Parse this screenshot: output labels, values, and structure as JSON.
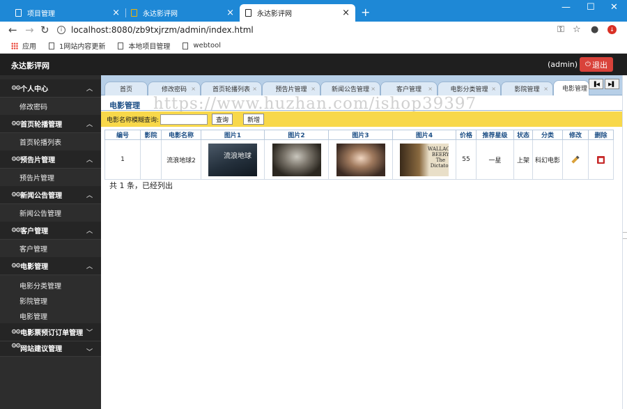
{
  "browser": {
    "tabs": [
      {
        "title": "项目管理"
      },
      {
        "title": "永达影评网"
      },
      {
        "title": "永达影评网"
      }
    ],
    "url": "localhost:8080/zb9txjrzm/admin/index.html",
    "bookmarks": [
      "应用",
      "1网站内容更新",
      "本地项目管理",
      "webtool"
    ]
  },
  "header": {
    "brand": "永达影评网",
    "user": "(admin)",
    "logout_label": "退出"
  },
  "sidebar": {
    "groups": [
      {
        "label": "个人中心",
        "items": [
          "修改密码"
        ]
      },
      {
        "label": "首页轮播管理",
        "items": [
          "首页轮播列表"
        ]
      },
      {
        "label": "预告片管理",
        "items": [
          "预告片管理"
        ]
      },
      {
        "label": "新闻公告管理",
        "items": [
          "新闻公告管理"
        ]
      },
      {
        "label": "客户管理",
        "items": [
          "客户管理"
        ]
      },
      {
        "label": "电影管理",
        "items": [
          "电影分类管理",
          "影院管理",
          "电影管理"
        ]
      },
      {
        "label": "电影票预订订单管理",
        "items": []
      },
      {
        "label": "网站建议管理",
        "items": []
      }
    ]
  },
  "frame_tabs": [
    "首页",
    "修改密码",
    "首页轮播列表",
    "预告片管理",
    "新闻公告管理",
    "客户管理",
    "电影分类管理",
    "影院管理",
    "电影管理"
  ],
  "page": {
    "title": "电影管理",
    "watermark": "https://www.huzhan.com/ishop39397",
    "search_label": "电影名称模糊查询:",
    "search_value": "",
    "query_button": "查询",
    "add_button": "新增",
    "total_text": "共 1 条，已经列出"
  },
  "table": {
    "columns": [
      "编号",
      "影院",
      "电影名称",
      "图片1",
      "图片2",
      "图片3",
      "图片4",
      "价格",
      "推荐星级",
      "状态",
      "分类",
      "修改",
      "删除"
    ],
    "rows": [
      {
        "id": "1",
        "cinema": "",
        "name": "流浪地球2",
        "price": "55",
        "stars": "一星",
        "status": "上架",
        "category": "科幻电影"
      }
    ],
    "poster1_text": "流浪地球",
    "poster4_text": "WALLACE BEERY The Dictator"
  }
}
